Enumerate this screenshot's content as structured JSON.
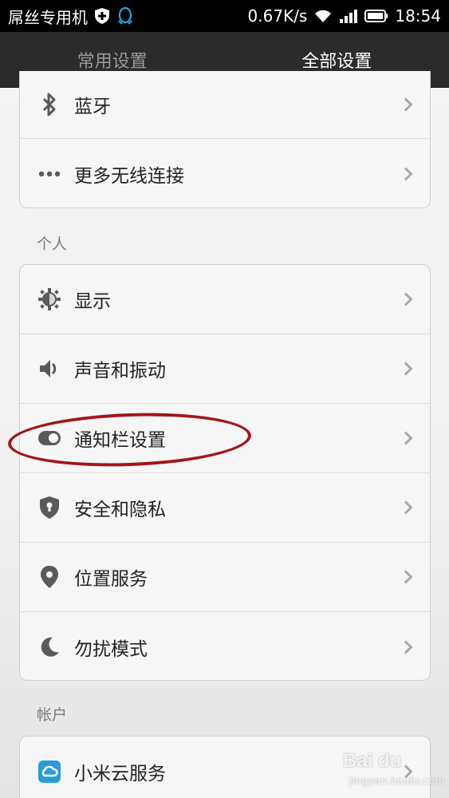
{
  "status_bar": {
    "carrier": "屌丝专用机",
    "speed": "0.67K/s",
    "time": "18:54"
  },
  "tabs": [
    {
      "label": "常用设置",
      "active": false
    },
    {
      "label": "全部设置",
      "active": true
    }
  ],
  "wireless_group": [
    {
      "label": "蓝牙",
      "icon": "bluetooth-icon"
    },
    {
      "label": "更多无线连接",
      "icon": "more-dots-icon"
    }
  ],
  "personal_section": {
    "title": "个人"
  },
  "personal_group": [
    {
      "label": "显示",
      "icon": "brightness-icon"
    },
    {
      "label": "声音和振动",
      "icon": "speaker-icon"
    },
    {
      "label": "通知栏设置",
      "icon": "toggle-icon"
    },
    {
      "label": "安全和隐私",
      "icon": "shield-lock-icon"
    },
    {
      "label": "位置服务",
      "icon": "location-pin-icon"
    },
    {
      "label": "勿扰模式",
      "icon": "moon-icon"
    }
  ],
  "account_section": {
    "title": "帐户"
  },
  "account_group": [
    {
      "label": "小米云服务",
      "icon": "cloud-icon"
    }
  ],
  "watermark": {
    "brand": "Bai du",
    "sub": "jingyan.baidu.com"
  },
  "colors": {
    "annotation": "#a3151a",
    "cloud_icon": "#2a9bd8"
  }
}
